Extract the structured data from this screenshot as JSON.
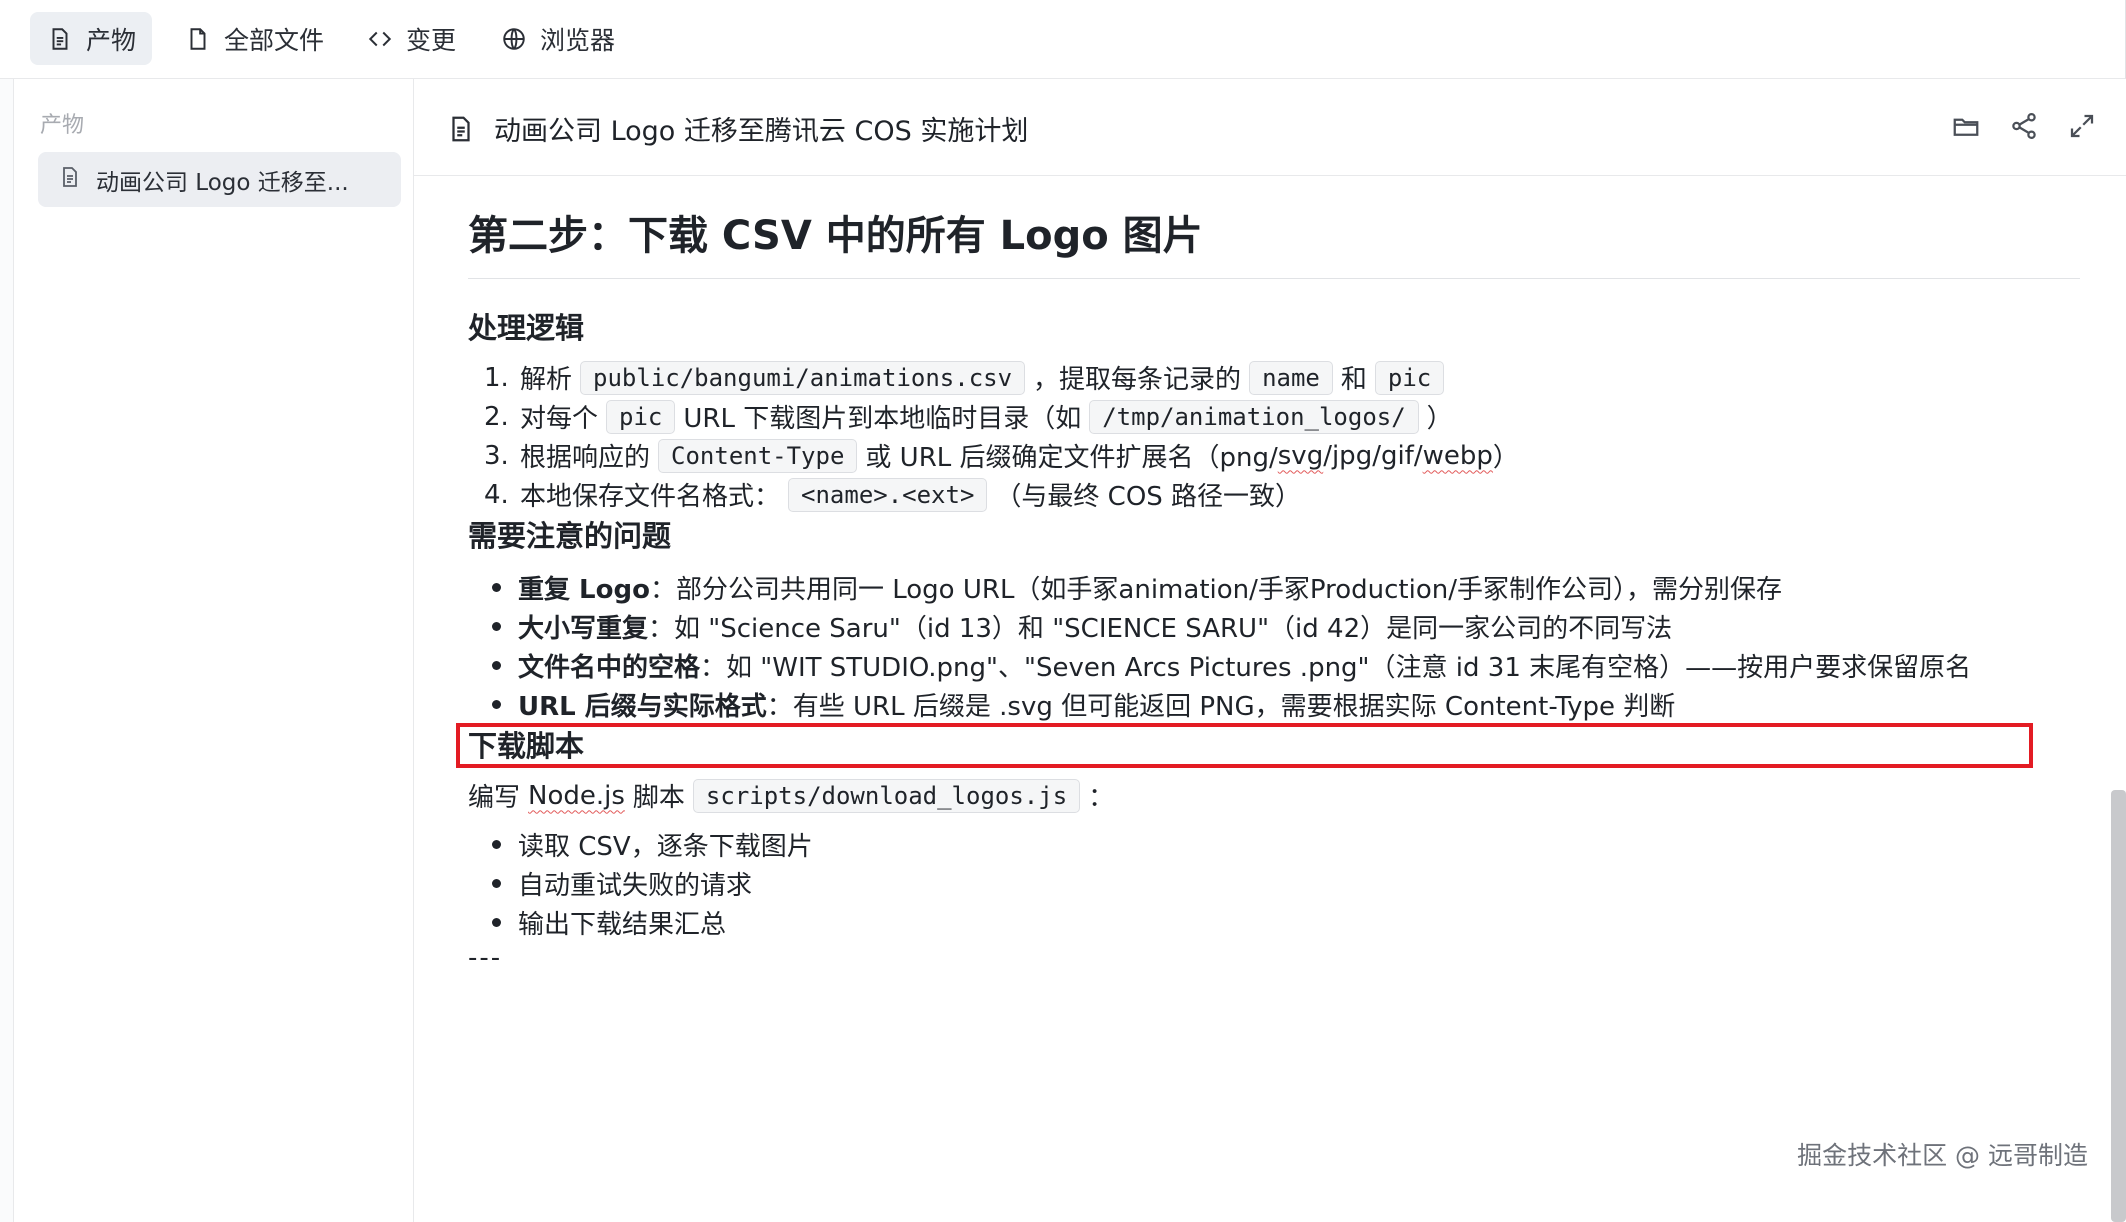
{
  "tabs": [
    {
      "label": "产物",
      "icon": "document-icon",
      "active": true
    },
    {
      "label": "全部文件",
      "icon": "file-icon",
      "active": false
    },
    {
      "label": "变更",
      "icon": "code-icon",
      "active": false
    },
    {
      "label": "浏览器",
      "icon": "globe-icon",
      "active": false
    }
  ],
  "sidebar": {
    "heading": "产物",
    "item_label": "动画公司 Logo 迁移至..."
  },
  "document": {
    "title": "动画公司 Logo 迁移至腾讯云 COS 实施计划",
    "actions": [
      "folder-open-icon",
      "share-icon",
      "expand-icon"
    ],
    "h1": "第二步：下载 CSV 中的所有 Logo 图片",
    "section1": {
      "heading": "处理逻辑",
      "steps": [
        {
          "num": "1.",
          "pre": "解析",
          "code1": "public/bangumi/animations.csv",
          "mid": "，提取每条记录的",
          "code2": "name",
          "mid2": "和",
          "code3": "pic"
        },
        {
          "num": "2.",
          "pre": "对每个",
          "code1": "pic",
          "mid": "URL 下载图片到本地临时目录（如",
          "code2": "/tmp/animation_logos/",
          "post": "）"
        },
        {
          "num": "3.",
          "pre": "根据响应的",
          "code1": "Content-Type",
          "mid_a": "或 URL 后缀确定文件扩展名（png/",
          "svg": "svg",
          "mid_b": "/jpg/gif/",
          "webp": "webp",
          "post": "）"
        },
        {
          "num": "4.",
          "pre": "本地保存文件名格式：",
          "code1": "<name>.<ext>",
          "post": "（与最终 COS 路径一致）"
        }
      ]
    },
    "section2": {
      "heading": "需要注意的问题",
      "bullets": [
        {
          "bold": "重复 Logo",
          "text": "：部分公司共用同一 Logo URL（如手冢animation/手冢Production/手冢制作公司），需分别保存"
        },
        {
          "bold": "大小写重复",
          "text": "：如 \"Science Saru\"（id 13）和 \"SCIENCE SARU\"（id 42）是同一家公司的不同写法"
        },
        {
          "bold": "文件名中的空格",
          "text": "：如 \"WIT STUDIO.png\"、\"Seven Arcs Pictures .png\"（注意 id 31 末尾有空格）——按用户要求保留原名"
        },
        {
          "bold": "URL 后缀与实际格式",
          "text": "：有些 URL 后缀是 .svg 但可能返回 PNG，需要根据实际 Content-Type 判断"
        }
      ]
    },
    "section3": {
      "heading": "下载脚本",
      "intro_pre": "编写",
      "intro_nodejs": "Node.js",
      "intro_mid": "脚本",
      "intro_code": "scripts/download_logos.js",
      "intro_post": "：",
      "bullets": [
        "读取 CSV，逐条下载图片",
        "自动重试失败的请求",
        "输出下载结果汇总"
      ]
    },
    "hr_text": "---"
  },
  "watermark": "掘金技术社区 @ 远哥制造",
  "colors": {
    "highlight": "#e31b23",
    "active_tab": "#eceff3"
  }
}
